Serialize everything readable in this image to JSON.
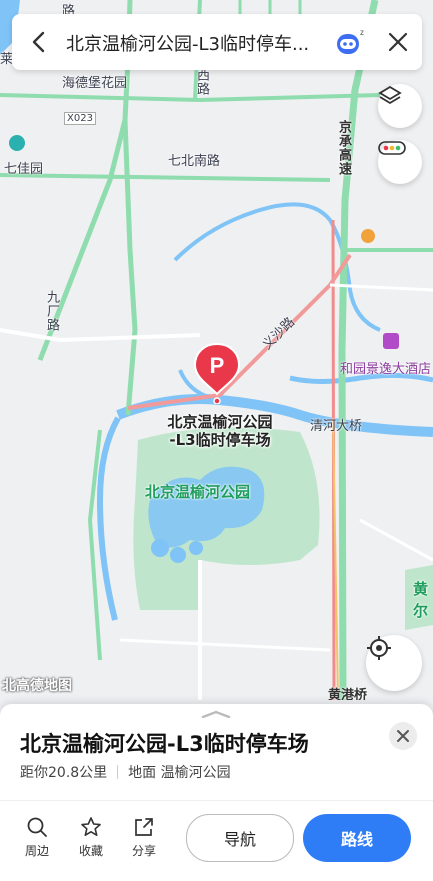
{
  "search": {
    "title": "北京温榆河公园-L3临时停车..."
  },
  "map": {
    "labels": {
      "haide": "海德堡花园",
      "x023": "X023",
      "qijia": "七佳园",
      "qibeinan": "七北南路",
      "jingcheng": "京承高速",
      "jiuchang": "九厂路",
      "yisha": "义沙路",
      "heyuan": "和园景逸大酒店",
      "qinghe": "清河大桥",
      "park": "北京温榆河公园",
      "huanggang": "黄港桥",
      "xilu": "西路",
      "road_top": "路",
      "lai": "莱",
      "huang_edge": "黄",
      "er_edge": "尔"
    },
    "pin_label_line1": "北京温榆河公园",
    "pin_label_line2": "-L3临时停车场",
    "watermark": "北高德地图"
  },
  "place": {
    "name": "北京温榆河公园-L3临时停车场",
    "distance": "距你20.8公里",
    "location": "地面 温榆河公园"
  },
  "actions": {
    "nearby": "周边",
    "favorite": "收藏",
    "share": "分享"
  },
  "buttons": {
    "navigate": "导航",
    "route": "路线"
  },
  "colors": {
    "accent": "#2f7df6",
    "pin": "#e8384a",
    "park": "#bfe6cc",
    "water": "#7fc3f7",
    "road_green": "#8fdcae"
  }
}
